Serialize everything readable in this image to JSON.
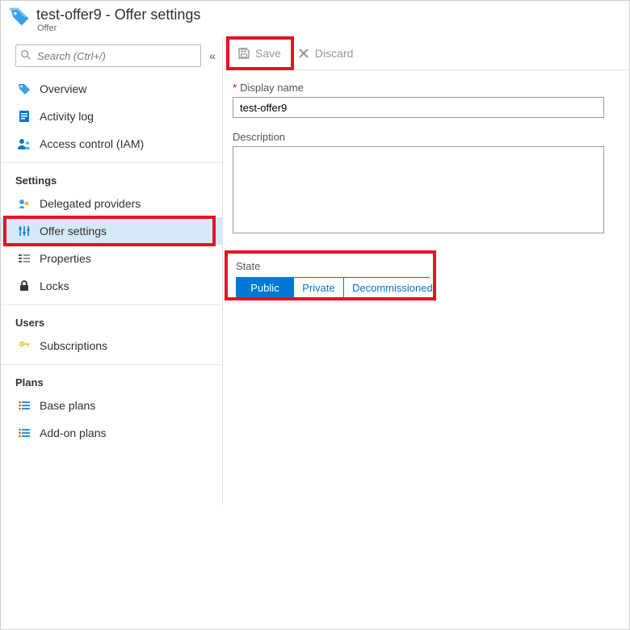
{
  "header": {
    "title": "test-offer9 - Offer settings",
    "subtype": "Offer"
  },
  "search": {
    "placeholder": "Search (Ctrl+/)"
  },
  "nav": {
    "overview": "Overview",
    "activity_log": "Activity log",
    "access_control": "Access control (IAM)",
    "group_settings": "Settings",
    "delegated_providers": "Delegated providers",
    "offer_settings": "Offer settings",
    "properties": "Properties",
    "locks": "Locks",
    "group_users": "Users",
    "subscriptions": "Subscriptions",
    "group_plans": "Plans",
    "base_plans": "Base plans",
    "addon_plans": "Add-on plans"
  },
  "toolbar": {
    "save_label": "Save",
    "discard_label": "Discard"
  },
  "form": {
    "display_name_label": "Display name",
    "display_name_value": "test-offer9",
    "description_label": "Description",
    "description_value": "",
    "state_label": "State",
    "state_options": {
      "public": "Public",
      "private": "Private",
      "decommissioned": "Decommissioned"
    },
    "state_selected": "public"
  }
}
